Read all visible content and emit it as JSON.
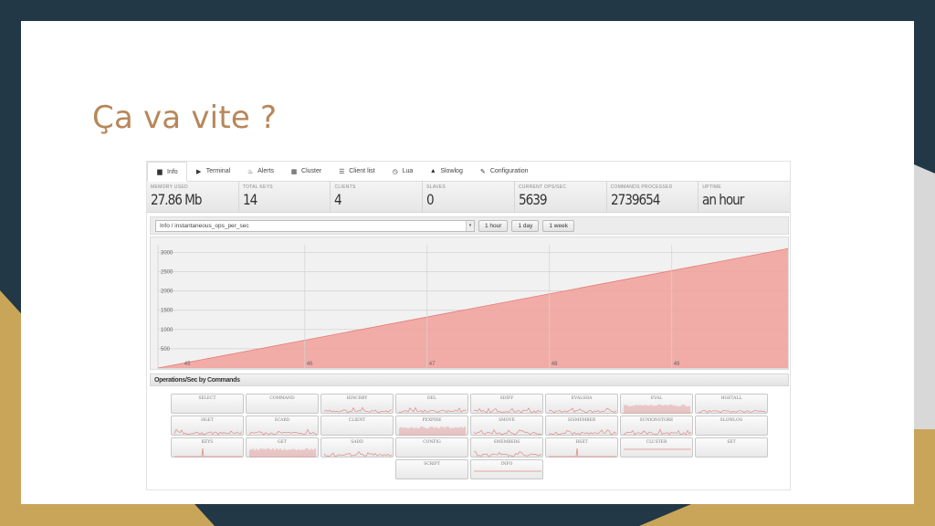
{
  "slide": {
    "title": "Ça va vite ?"
  },
  "nav": [
    {
      "label": "Info",
      "icon": "dashboard-icon",
      "glyph": "▆",
      "active": true
    },
    {
      "label": "Terminal",
      "icon": "play-icon",
      "glyph": "▶"
    },
    {
      "label": "Alerts",
      "icon": "fire-icon",
      "glyph": "♨"
    },
    {
      "label": "Cluster",
      "icon": "cluster-icon",
      "glyph": "▦"
    },
    {
      "label": "Client list",
      "icon": "list-icon",
      "glyph": "☰"
    },
    {
      "label": "Lua",
      "icon": "clock-icon",
      "glyph": "◷"
    },
    {
      "label": "Slowlog",
      "icon": "road-icon",
      "glyph": "▲"
    },
    {
      "label": "Configuration",
      "icon": "wrench-icon",
      "glyph": "✎"
    }
  ],
  "stats": [
    {
      "label": "Memory used",
      "value": "27.86 Mb"
    },
    {
      "label": "Total keys",
      "value": "14"
    },
    {
      "label": "Clients",
      "value": "4"
    },
    {
      "label": "Slaves",
      "value": "0"
    },
    {
      "label": "Current ops/sec",
      "value": "5639"
    },
    {
      "label": "Commands processed",
      "value": "2739654"
    },
    {
      "label": "Uptime",
      "value": "an hour"
    }
  ],
  "toolbar": {
    "metric": "Info / instantaneous_ops_per_sec",
    "ranges": [
      "1 hour",
      "1 day",
      "1 week"
    ]
  },
  "chart_data": {
    "type": "area",
    "x_ticks": [
      "45",
      "46",
      "47",
      "48",
      "49"
    ],
    "y_ticks": [
      500,
      1000,
      1500,
      2000,
      2500,
      3000
    ],
    "ylim": [
      0,
      3200
    ],
    "x": [
      44.8,
      49.95
    ],
    "y": [
      0,
      3100
    ],
    "color": "#f2a09a",
    "grid": true
  },
  "ops": {
    "header": "Operations/Sec by Commands",
    "color": "#e08a8a",
    "items": [
      {
        "label": "SELECT",
        "spark": "none"
      },
      {
        "label": "COMMAND",
        "spark": "none"
      },
      {
        "label": "HINCRBY",
        "spark": "noise"
      },
      {
        "label": "DEL",
        "spark": "noise"
      },
      {
        "label": "SDIFF",
        "spark": "noise"
      },
      {
        "label": "EVALSHA",
        "spark": "noise"
      },
      {
        "label": "EVAL",
        "spark": "dense"
      },
      {
        "label": "HGETALL",
        "spark": "noise"
      },
      {
        "label": "HGET",
        "spark": "noise"
      },
      {
        "label": "SCARD",
        "spark": "noise"
      },
      {
        "label": "CLIENT",
        "spark": "none"
      },
      {
        "label": "PEXPIRE",
        "spark": "dense"
      },
      {
        "label": "SMOVE",
        "spark": "noise"
      },
      {
        "label": "SISMEMBER",
        "spark": "noise"
      },
      {
        "label": "SUNIONSTORE",
        "spark": "noise"
      },
      {
        "label": "SLOWLOG",
        "spark": "none"
      },
      {
        "label": "KEYS",
        "spark": "spike"
      },
      {
        "label": "GET",
        "spark": "dense"
      },
      {
        "label": "SADD",
        "spark": "noise"
      },
      {
        "label": "CONFIG",
        "spark": "none"
      },
      {
        "label": "SMEMBERS",
        "spark": "noise"
      },
      {
        "label": "HSET",
        "spark": "spike"
      },
      {
        "label": "CLUSTER",
        "spark": "flat"
      },
      {
        "label": "SET",
        "spark": "none"
      },
      {
        "label": "SCRIPT",
        "spark": "none",
        "col": 4
      },
      {
        "label": "INFO",
        "spark": "flat",
        "col": 5
      }
    ]
  }
}
